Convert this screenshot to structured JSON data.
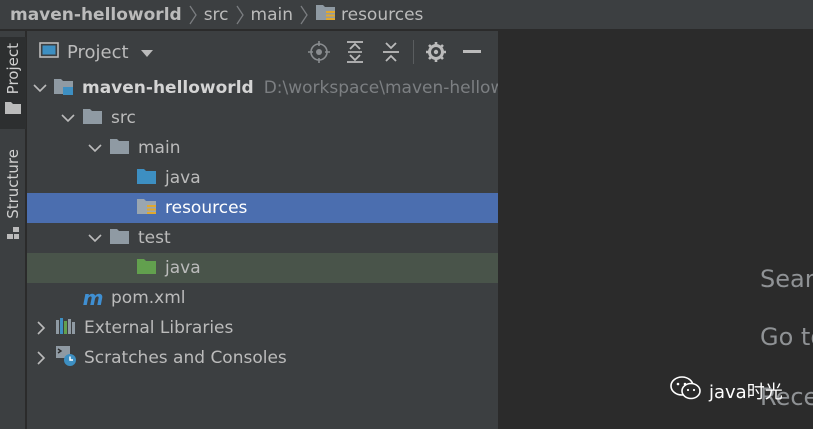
{
  "breadcrumb": {
    "items": [
      "maven-helloworld",
      "src",
      "main",
      "resources"
    ]
  },
  "toolwindow_strip": {
    "tabs": [
      "Project",
      "Structure"
    ]
  },
  "project_panel": {
    "title": "Project",
    "tools": [
      "locate-icon",
      "expand-all-icon",
      "collapse-all-icon",
      "gear-icon",
      "minimize-icon"
    ]
  },
  "tree": {
    "root_name": "maven-helloworld",
    "root_path": "D:\\workspace\\maven-hellow",
    "src": "src",
    "main": "main",
    "main_java": "java",
    "resources": "resources",
    "test": "test",
    "test_java": "java",
    "pom": "pom.xml",
    "pom_glyph": "m",
    "external_libraries": "External Libraries",
    "scratches": "Scratches and Consoles"
  },
  "editor": {
    "hints": [
      "Searc",
      "Go to",
      "Rece"
    ]
  },
  "watermark": {
    "text": "java时光"
  },
  "colors": {
    "selection": "#4b6eaf",
    "test_highlight": "#49544a",
    "folder_gray": "#8f9aa3",
    "folder_blue": "#3d8fc2",
    "folder_green": "#62a04e",
    "maven_blue": "#3f8fd2"
  }
}
